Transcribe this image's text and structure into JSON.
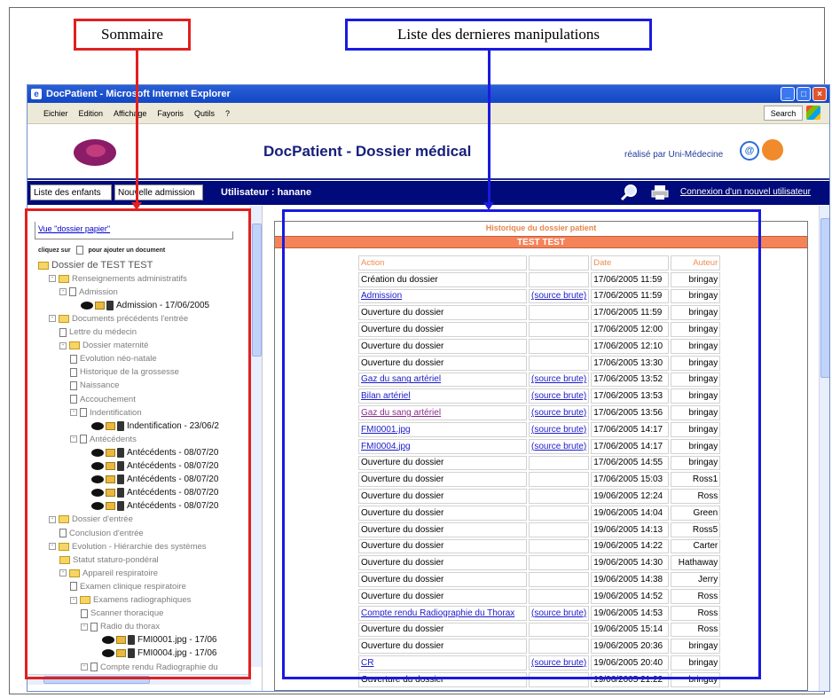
{
  "callouts": {
    "sommaire": "Sommaire",
    "liste": "Liste des dernieres manipulations"
  },
  "window": {
    "title": "DocPatient - Microsoft Internet Explorer",
    "menus": [
      "Eichier",
      "Edition",
      "Affichage",
      "Fayoris",
      "Qutils",
      "?"
    ],
    "search_label": "Search",
    "controls": {
      "minimize": "_",
      "maximize": "□",
      "close": "×"
    }
  },
  "app": {
    "title": "DocPatient - Dossier médical",
    "credit": "réalisé par Uni-Médecine",
    "credit_icon_text": "@"
  },
  "nav": {
    "btn_enfants": "Liste des enfants",
    "btn_admission": "Nouvelle admission",
    "user": "Utilisateur : hanane",
    "connexion": "Connexion d'un nouvel utilisateur"
  },
  "tree": {
    "vue_link": "Vue \"dossier papier\"",
    "hint_before": "cliquez sur",
    "hint_after": "pour ajouter un document",
    "items": [
      {
        "label": "Dossier de TEST TEST",
        "depth": 0,
        "type": "root"
      },
      {
        "label": "Renseignements administratifs",
        "depth": 1,
        "type": "folder",
        "toggle": "-"
      },
      {
        "label": "Admission",
        "depth": 2,
        "type": "doc",
        "toggle": "-"
      },
      {
        "label": "Admission - 17/06/2005",
        "depth": 4,
        "type": "entry"
      },
      {
        "label": "Documents précédents l'entrée",
        "depth": 1,
        "type": "folder",
        "toggle": "-"
      },
      {
        "label": "Lettre du médecin",
        "depth": 2,
        "type": "doc"
      },
      {
        "label": "Dossier maternité",
        "depth": 2,
        "type": "folder",
        "toggle": "-"
      },
      {
        "label": "Evolution néo-natale",
        "depth": 3,
        "type": "doc"
      },
      {
        "label": "Historique de la grossesse",
        "depth": 3,
        "type": "doc"
      },
      {
        "label": "Naissance",
        "depth": 3,
        "type": "doc"
      },
      {
        "label": "Accouchement",
        "depth": 3,
        "type": "doc"
      },
      {
        "label": "Indentification",
        "depth": 3,
        "type": "doc",
        "toggle": "-"
      },
      {
        "label": "Indentification - 23/06/2",
        "depth": 5,
        "type": "entry"
      },
      {
        "label": "Antécédents",
        "depth": 3,
        "type": "doc",
        "toggle": "-"
      },
      {
        "label": "Antécédents - 08/07/20",
        "depth": 5,
        "type": "entry"
      },
      {
        "label": "Antécédents - 08/07/20",
        "depth": 5,
        "type": "entry"
      },
      {
        "label": "Antécédents - 08/07/20",
        "depth": 5,
        "type": "entry"
      },
      {
        "label": "Antécédents - 08/07/20",
        "depth": 5,
        "type": "entry"
      },
      {
        "label": "Antécédents - 08/07/20",
        "depth": 5,
        "type": "entry"
      },
      {
        "label": "Dossier d'entrée",
        "depth": 1,
        "type": "folder",
        "toggle": "-"
      },
      {
        "label": "Conclusion d'entrée",
        "depth": 2,
        "type": "doc"
      },
      {
        "label": "Evolution - Hiérarchie des systèmes",
        "depth": 1,
        "type": "folder",
        "toggle": "-"
      },
      {
        "label": "Statut staturo-pondéral",
        "depth": 2,
        "type": "folder"
      },
      {
        "label": "Appareil respiratoire",
        "depth": 2,
        "type": "folder",
        "toggle": "-"
      },
      {
        "label": "Examen clinique respiratoire",
        "depth": 3,
        "type": "doc"
      },
      {
        "label": "Examens radiographiques",
        "depth": 3,
        "type": "folder",
        "toggle": "-"
      },
      {
        "label": "Scanner thoracique",
        "depth": 4,
        "type": "doc"
      },
      {
        "label": "Radio du thorax",
        "depth": 4,
        "type": "doc",
        "toggle": "-"
      },
      {
        "label": "FMI0001.jpg - 17/06",
        "depth": 6,
        "type": "entry"
      },
      {
        "label": "FMI0004.jpg - 17/06",
        "depth": 6,
        "type": "entry"
      },
      {
        "label": "Compte rendu Radiographie du",
        "depth": 4,
        "type": "doc",
        "toggle": "-"
      }
    ]
  },
  "history": {
    "title": "Historique du dossier patient",
    "patient": "TEST TEST",
    "columns": {
      "action": "Action",
      "src": "",
      "date": "Date",
      "auteur": "Auteur"
    },
    "rows": [
      {
        "action": "Création du dossier",
        "link": "",
        "src": "",
        "date": "17/06/2005 11:59",
        "auteur": "bringay"
      },
      {
        "action": "Admission",
        "link": "blue",
        "src": "(source brute)",
        "date": "17/06/2005 11:59",
        "auteur": "bringay"
      },
      {
        "action": "Ouverture du dossier",
        "link": "",
        "src": "",
        "date": "17/06/2005 11:59",
        "auteur": "bringay"
      },
      {
        "action": "Ouverture du dossier",
        "link": "",
        "src": "",
        "date": "17/06/2005 12:00",
        "auteur": "bringay"
      },
      {
        "action": "Ouverture du dossier",
        "link": "",
        "src": "",
        "date": "17/06/2005 12:10",
        "auteur": "bringay"
      },
      {
        "action": "Ouverture du dossier",
        "link": "",
        "src": "",
        "date": "17/06/2005 13:30",
        "auteur": "bringay"
      },
      {
        "action": "Gaz du sang artériel",
        "link": "blue",
        "src": "(source brute)",
        "date": "17/06/2005 13:52",
        "auteur": "bringay"
      },
      {
        "action": "Bilan artériel",
        "link": "blue",
        "src": "(source brute)",
        "date": "17/06/2005 13:53",
        "auteur": "bringay"
      },
      {
        "action": "Gaz du sang artériel",
        "link": "visited",
        "src": "(source brute)",
        "date": "17/06/2005 13:56",
        "auteur": "bringay"
      },
      {
        "action": "FMI0001.jpg",
        "link": "blue",
        "src": "(source brute)",
        "date": "17/06/2005 14:17",
        "auteur": "bringay"
      },
      {
        "action": "FMI0004.jpg",
        "link": "blue",
        "src": "(source brute)",
        "date": "17/06/2005 14:17",
        "auteur": "bringay"
      },
      {
        "action": "Ouverture du dossier",
        "link": "",
        "src": "",
        "date": "17/06/2005 14:55",
        "auteur": "bringay"
      },
      {
        "action": "Ouverture du dossier",
        "link": "",
        "src": "",
        "date": "17/06/2005 15:03",
        "auteur": "Ross1"
      },
      {
        "action": "Ouverture du dossier",
        "link": "",
        "src": "",
        "date": "19/06/2005 12:24",
        "auteur": "Ross"
      },
      {
        "action": "Ouverture du dossier",
        "link": "",
        "src": "",
        "date": "19/06/2005 14:04",
        "auteur": "Green"
      },
      {
        "action": "Ouverture du dossier",
        "link": "",
        "src": "",
        "date": "19/06/2005 14:13",
        "auteur": "Ross5"
      },
      {
        "action": "Ouverture du dossier",
        "link": "",
        "src": "",
        "date": "19/06/2005 14:22",
        "auteur": "Carter"
      },
      {
        "action": "Ouverture du dossier",
        "link": "",
        "src": "",
        "date": "19/06/2005 14:30",
        "auteur": "Hathaway"
      },
      {
        "action": "Ouverture du dossier",
        "link": "",
        "src": "",
        "date": "19/06/2005 14:38",
        "auteur": "Jerry"
      },
      {
        "action": "Ouverture du dossier",
        "link": "",
        "src": "",
        "date": "19/06/2005 14:52",
        "auteur": "Ross"
      },
      {
        "action": "Compte rendu Radiographie du Thorax",
        "link": "blue",
        "src": "(source brute)",
        "date": "19/06/2005 14:53",
        "auteur": "Ross"
      },
      {
        "action": "Ouverture du dossier",
        "link": "",
        "src": "",
        "date": "19/06/2005 15:14",
        "auteur": "Ross"
      },
      {
        "action": "Ouverture du dossier",
        "link": "",
        "src": "",
        "date": "19/06/2005 20:36",
        "auteur": "bringay"
      },
      {
        "action": "CR",
        "link": "blue",
        "src": "(source brute)",
        "date": "19/06/2005 20:40",
        "auteur": "bringay"
      },
      {
        "action": "Ouverture du dossier",
        "link": "",
        "src": "",
        "date": "19/06/2005 21:22",
        "auteur": "bringay"
      }
    ]
  },
  "colors": {
    "highlight_red": "#e02020",
    "highlight_blue": "#1a1ae0",
    "nav_bg": "#000a7a",
    "patient_bar": "#f4835a",
    "history_title": "#e7874a"
  },
  "icons": [
    "ie-icon",
    "magnifier-icon",
    "printer-icon",
    "eye-icon",
    "folder-open-icon",
    "trash-icon",
    "folder-icon",
    "doc-icon",
    "windows-flag-icon"
  ]
}
